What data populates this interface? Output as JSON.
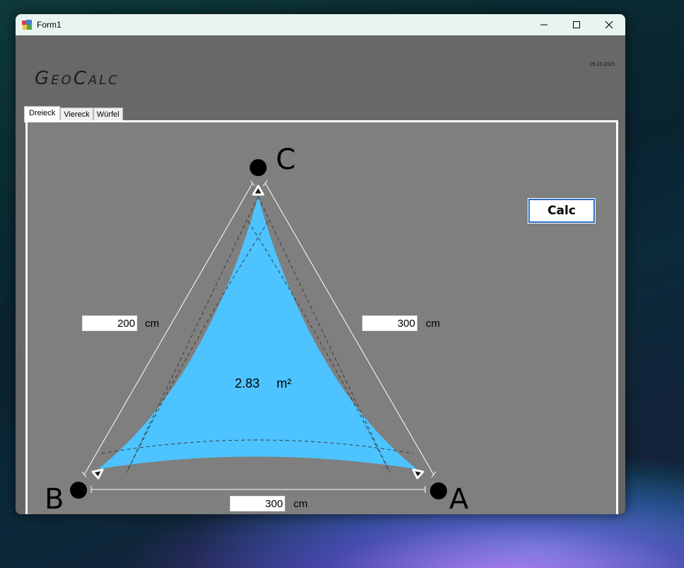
{
  "window": {
    "title": "Form1",
    "controls": {
      "minimize_icon": "minimize-icon",
      "maximize_icon": "maximize-icon",
      "close_icon": "close-icon"
    }
  },
  "header": {
    "logo": "GeoCalc",
    "date": "09.10.2023"
  },
  "tabs": [
    {
      "label": "Dreieck",
      "active": true
    },
    {
      "label": "Viereck",
      "active": false
    },
    {
      "label": "Würfel",
      "active": false
    }
  ],
  "triangle": {
    "vertices": {
      "a": "A",
      "b": "B",
      "c": "C"
    },
    "side_bc": {
      "value": "200",
      "unit": "cm"
    },
    "side_ca": {
      "value": "300",
      "unit": "cm"
    },
    "side_ab": {
      "value": "300",
      "unit": "cm"
    },
    "area": {
      "value": "2.83",
      "unit": "m²"
    },
    "sail_color": "#4dc3ff"
  },
  "buttons": {
    "calc": "Calc"
  }
}
